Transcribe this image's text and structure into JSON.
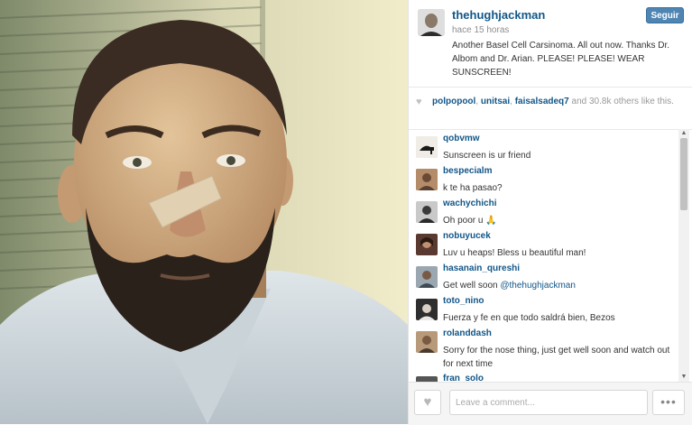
{
  "post": {
    "username": "thehughjackman",
    "time_ago": "hace 15 horas",
    "caption": "Another Basel Cell Carsinoma. All out now. Thanks Dr. Albom and Dr. Arian. PLEASE! PLEASE! WEAR SUNSCREEN!",
    "follow_label": "Seguir",
    "photo_icon": "selfie-photo"
  },
  "likes": {
    "users": [
      "polpopool",
      "unitsai",
      "faisalsadeq7"
    ],
    "sep": ", ",
    "and": " and ",
    "count": "30.8k",
    "suffix": " others like this."
  },
  "comments": [
    {
      "user": "qobvmw",
      "text": "Sunscreen is ur friend"
    },
    {
      "user": "bespecialm",
      "text": "k te ha pasao?"
    },
    {
      "user": "wachychichi",
      "text": "Oh poor u 🙏"
    },
    {
      "user": "nobuyucek",
      "text": "Luv u heaps! Bless u beautiful man!"
    },
    {
      "user": "hasanain_qureshi",
      "text": "Get well soon ",
      "mention": "@thehughjackman"
    },
    {
      "user": "toto_nino",
      "text": "Fuerza y fe en que todo saldrá bien, Bezos"
    },
    {
      "user": "rolanddash",
      "text": "Sorry for the nose thing, just get well soon and watch out for next time"
    },
    {
      "user": "fran_solo",
      "text": ""
    }
  ],
  "footer": {
    "comment_placeholder": "Leave a comment...",
    "more_label": "•••"
  },
  "colors": {
    "link": "#125688",
    "follow_button": "#4f85b3"
  }
}
